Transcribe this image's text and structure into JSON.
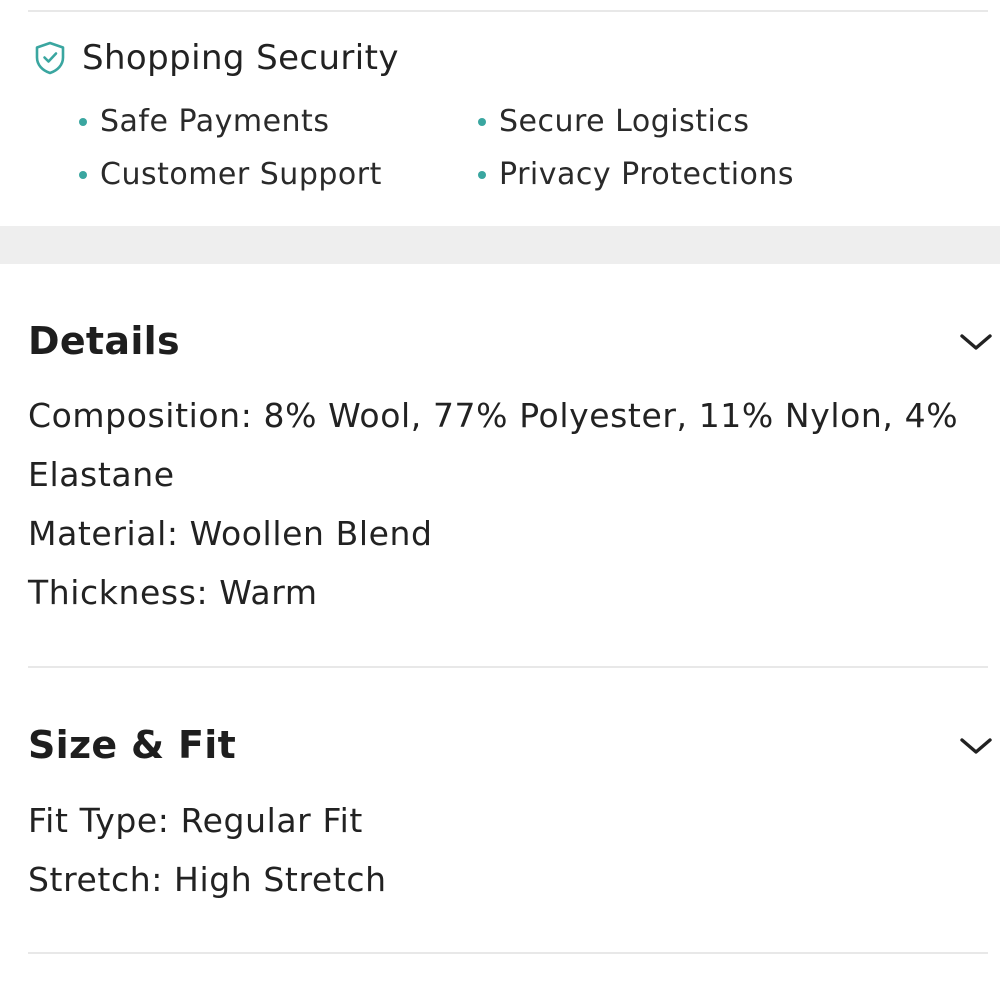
{
  "security": {
    "title": "Shopping Security",
    "icon": "shield-check-icon",
    "accent_color": "#3aa6a0",
    "items": [
      {
        "label": "Safe Payments"
      },
      {
        "label": "Secure Logistics"
      },
      {
        "label": "Customer Support"
      },
      {
        "label": "Privacy Protections"
      }
    ]
  },
  "details": {
    "title": "Details",
    "icon": "chevron-down-icon",
    "lines": [
      "Composition: 8% Wool, 77% Polyester, 11% Nylon, 4% Elastane",
      "Material: Woollen Blend",
      "Thickness: Warm"
    ]
  },
  "size_fit": {
    "title": "Size & Fit",
    "icon": "chevron-down-icon",
    "lines": [
      "Fit Type: Regular Fit",
      "Stretch: High Stretch"
    ]
  }
}
